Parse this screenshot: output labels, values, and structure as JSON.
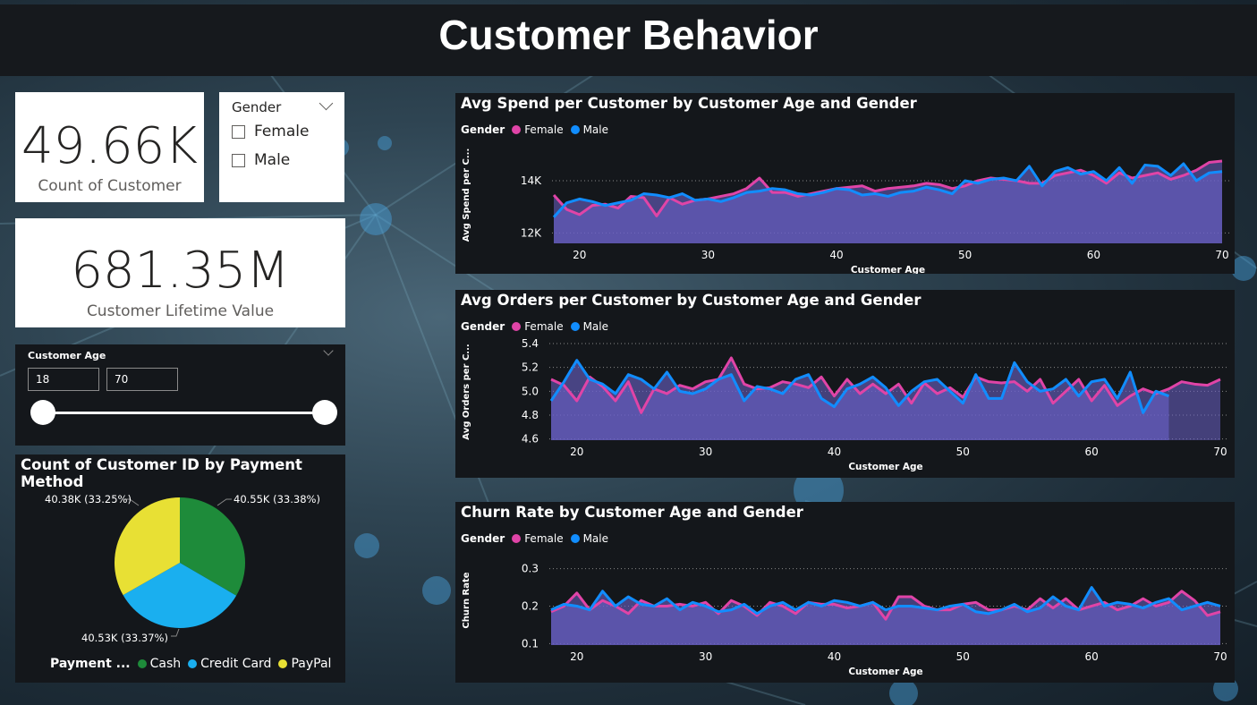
{
  "header": {
    "title": "Customer Behavior"
  },
  "kpis": {
    "count": {
      "value": "49.66K",
      "label": "Count of Customer"
    },
    "clv": {
      "value": "681.35M",
      "label": "Customer Lifetime Value"
    }
  },
  "gender_slicer": {
    "title": "Gender",
    "options": [
      "Female",
      "Male"
    ]
  },
  "age_slicer": {
    "title": "Customer Age",
    "min": "18",
    "max": "70"
  },
  "pie": {
    "title": "Count of Customer ID by Payment Method",
    "legend_title": "Payment ...",
    "labels": [
      "40.55K (33.38%)",
      "40.53K (33.37%)",
      "40.38K (33.25%)"
    ]
  },
  "colors": {
    "female": "#E044A7",
    "male": "#118DFF",
    "area": "#6B62C9",
    "cash": "#1E8B3A",
    "credit": "#1AAFEF",
    "paypal": "#E8E034"
  },
  "line_charts": [
    {
      "title": "Avg Spend per Customer by Customer Age and Gender",
      "legend_title": "Gender",
      "series_names": [
        "Female",
        "Male"
      ],
      "ylabel": "Avg Spend per C...",
      "xlabel": "Customer Age",
      "x_ticks": [
        "20",
        "30",
        "40",
        "50",
        "60",
        "70"
      ],
      "y_ticks": [
        "14K",
        "12K"
      ]
    },
    {
      "title": "Avg Orders per Customer by Customer Age and Gender",
      "legend_title": "Gender",
      "series_names": [
        "Female",
        "Male"
      ],
      "ylabel": "Avg Orders per C...",
      "xlabel": "Customer Age",
      "x_ticks": [
        "20",
        "30",
        "40",
        "50",
        "60",
        "70"
      ],
      "y_ticks": [
        "5.4",
        "5.2",
        "5.0",
        "4.8",
        "4.6"
      ]
    },
    {
      "title": "Churn Rate by Customer Age and Gender",
      "legend_title": "Gender",
      "series_names": [
        "Female",
        "Male"
      ],
      "ylabel": "Churn Rate",
      "xlabel": "Customer Age",
      "x_ticks": [
        "20",
        "30",
        "40",
        "50",
        "60",
        "70"
      ],
      "y_ticks": [
        "0.3",
        "0.2",
        "0.1"
      ]
    }
  ],
  "chart_data": [
    {
      "type": "pie",
      "title": "Count of Customer ID by Payment Method",
      "categories": [
        "Cash",
        "Credit Card",
        "PayPal"
      ],
      "values": [
        40550,
        40530,
        40380
      ],
      "labels": [
        "40.55K (33.38%)",
        "40.53K (33.37%)",
        "40.38K (33.25%)"
      ]
    },
    {
      "type": "area",
      "title": "Avg Spend per Customer by Customer Age and Gender",
      "xlabel": "Customer Age",
      "xlim": [
        18,
        70
      ],
      "ylim": [
        11600,
        15300
      ],
      "x_start": 18,
      "series": [
        {
          "name": "Female",
          "values": [
            13450,
            12900,
            12700,
            13050,
            13100,
            12950,
            13400,
            13350,
            12650,
            13350,
            13100,
            13250,
            13300,
            13400,
            13500,
            13700,
            14100,
            13550,
            13550,
            13400,
            13500,
            13600,
            13700,
            13750,
            13800,
            13600,
            13700,
            13750,
            13800,
            13900,
            13850,
            13700,
            13800,
            14000,
            14100,
            14050,
            14000,
            13900,
            13900,
            14200,
            14300,
            14400,
            14200,
            13900,
            14300,
            14100,
            14200,
            14300,
            14050,
            14200,
            14400,
            14700,
            14750
          ]
        },
        {
          "name": "Male",
          "values": [
            12600,
            13150,
            13300,
            13200,
            13050,
            13150,
            13250,
            13500,
            13450,
            13350,
            13500,
            13250,
            13300,
            13200,
            13350,
            13550,
            13600,
            13700,
            13650,
            13500,
            13450,
            13550,
            13700,
            13650,
            13450,
            13500,
            13400,
            13550,
            13600,
            13750,
            13650,
            13500,
            14000,
            13900,
            14050,
            14100,
            14000,
            14550,
            13800,
            14350,
            14500,
            14250,
            14350,
            14000,
            14500,
            13900,
            14600,
            14550,
            14200,
            14650,
            14000,
            14300,
            14350
          ]
        }
      ]
    },
    {
      "type": "area",
      "title": "Avg Orders per Customer by Customer Age and Gender",
      "xlabel": "Customer Age",
      "xlim": [
        18,
        70
      ],
      "ylim": [
        4.59,
        5.4
      ],
      "x_start": 18,
      "series": [
        {
          "name": "Female",
          "values": [
            5.1,
            5.05,
            4.92,
            5.12,
            5.04,
            4.92,
            5.08,
            4.82,
            5.02,
            4.98,
            5.05,
            5.02,
            5.08,
            5.1,
            5.28,
            5.06,
            5.02,
            5.03,
            5.08,
            5.06,
            5.03,
            5.12,
            4.96,
            5.1,
            4.98,
            5.06,
            4.98,
            5.06,
            4.9,
            5.07,
            4.98,
            5.03,
            4.95,
            5.12,
            5.08,
            5.07,
            5.08,
            5.0,
            5.1,
            4.9,
            5.0,
            5.1,
            4.92,
            5.05,
            4.88,
            4.96,
            5.02,
            4.98,
            5.02,
            5.08,
            5.06,
            5.05,
            5.1
          ]
        },
        {
          "name": "Male",
          "values": [
            4.92,
            5.08,
            5.26,
            5.1,
            5.06,
            4.98,
            5.14,
            5.1,
            5.02,
            5.16,
            5.0,
            4.98,
            5.02,
            5.1,
            5.14,
            4.92,
            5.04,
            5.02,
            4.98,
            5.1,
            5.14,
            4.94,
            4.87,
            5.02,
            5.06,
            5.12,
            5.03,
            4.88,
            5.0,
            5.08,
            5.1,
            5.0,
            4.9,
            5.14,
            4.94,
            4.94,
            5.24,
            5.08,
            5.0,
            5.02,
            5.1,
            4.96,
            5.08,
            5.1,
            4.94,
            5.16,
            4.82,
            5.0,
            4.96
          ]
        }
      ]
    },
    {
      "type": "area",
      "title": "Churn Rate by Customer Age and Gender",
      "xlabel": "Customer Age",
      "xlim": [
        18,
        70
      ],
      "ylim": [
        0.096,
        0.335
      ],
      "x_start": 18,
      "series": [
        {
          "name": "Female",
          "values": [
            0.185,
            0.2,
            0.235,
            0.19,
            0.215,
            0.2,
            0.18,
            0.215,
            0.2,
            0.2,
            0.205,
            0.2,
            0.21,
            0.18,
            0.215,
            0.2,
            0.175,
            0.21,
            0.2,
            0.18,
            0.21,
            0.205,
            0.205,
            0.195,
            0.2,
            0.21,
            0.165,
            0.225,
            0.225,
            0.2,
            0.19,
            0.19,
            0.205,
            0.21,
            0.19,
            0.19,
            0.2,
            0.19,
            0.22,
            0.195,
            0.22,
            0.19,
            0.2,
            0.21,
            0.19,
            0.2,
            0.22,
            0.2,
            0.21,
            0.24,
            0.215,
            0.175,
            0.185
          ]
        },
        {
          "name": "Male",
          "values": [
            0.19,
            0.205,
            0.2,
            0.19,
            0.24,
            0.2,
            0.225,
            0.205,
            0.2,
            0.22,
            0.19,
            0.21,
            0.2,
            0.185,
            0.19,
            0.205,
            0.18,
            0.2,
            0.21,
            0.19,
            0.21,
            0.2,
            0.215,
            0.21,
            0.2,
            0.21,
            0.19,
            0.2,
            0.2,
            0.195,
            0.19,
            0.2,
            0.205,
            0.185,
            0.18,
            0.19,
            0.205,
            0.185,
            0.195,
            0.225,
            0.2,
            0.19,
            0.25,
            0.2,
            0.21,
            0.205,
            0.195,
            0.21,
            0.22,
            0.19,
            0.2,
            0.21,
            0.2
          ]
        }
      ]
    }
  ]
}
